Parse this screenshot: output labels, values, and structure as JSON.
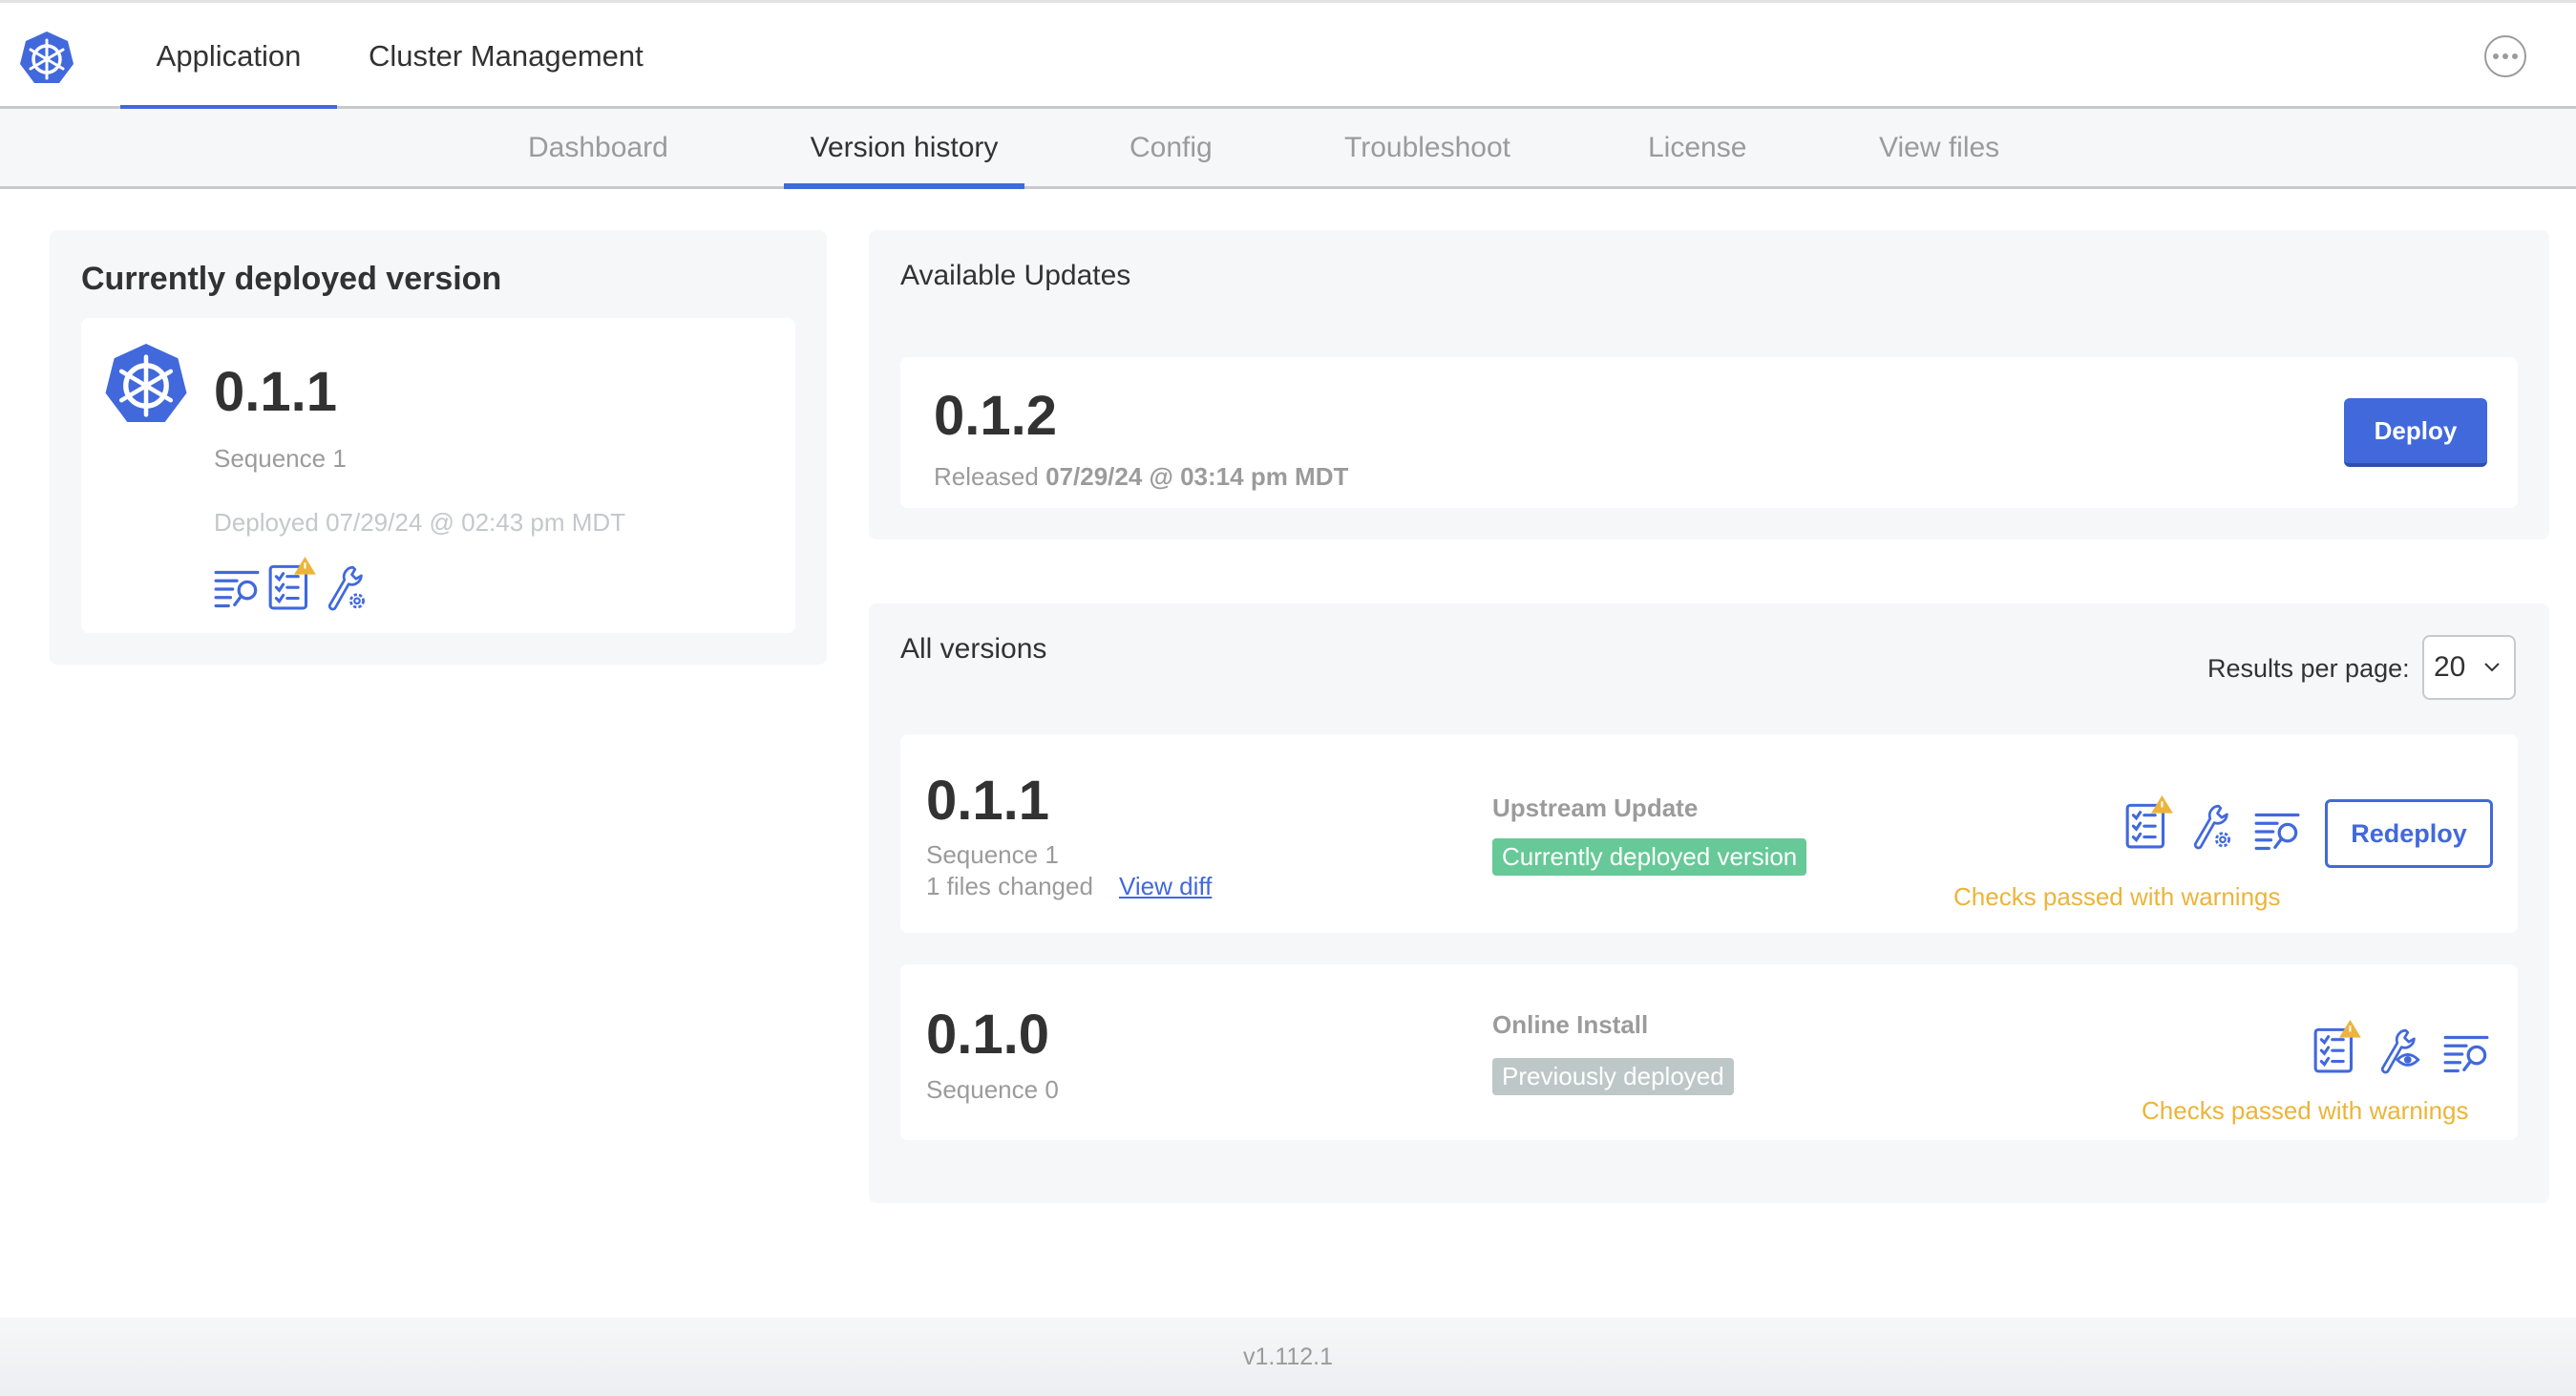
{
  "header": {
    "logo_icon": "kubernetes-helm-logo-icon",
    "tabs": [
      {
        "label": "Application",
        "active": true
      },
      {
        "label": "Cluster Management",
        "active": false
      }
    ],
    "more_icon": "ellipsis-circle-icon"
  },
  "subnav": {
    "tabs": [
      {
        "label": "Dashboard",
        "active": false
      },
      {
        "label": "Version history",
        "active": true
      },
      {
        "label": "Config",
        "active": false
      },
      {
        "label": "Troubleshoot",
        "active": false
      },
      {
        "label": "License",
        "active": false
      },
      {
        "label": "View files",
        "active": false
      }
    ]
  },
  "current": {
    "title": "Currently deployed version",
    "version": "0.1.1",
    "sequence": "Sequence 1",
    "deployed": "Deployed 07/29/24 @ 02:43 pm MDT",
    "icons": [
      "view-logs-icon",
      "preflight-checks-warning-icon",
      "edit-config-icon"
    ]
  },
  "updates": {
    "title": "Available Updates",
    "version": "0.1.2",
    "released_label": "Released",
    "released_date": "07/29/24 @ 03:14 pm MDT",
    "deploy_label": "Deploy"
  },
  "all_versions": {
    "title": "All versions",
    "results_label": "Results per page:",
    "results_value": "20",
    "rows": [
      {
        "version": "0.1.1",
        "sequence": "Sequence 1",
        "files_changed": "1 files changed",
        "view_diff": "View diff",
        "source": "Upstream Update",
        "status": "Currently deployed version",
        "status_color": "#66c997",
        "checks": "Checks passed with warnings",
        "action": "Redeploy"
      },
      {
        "version": "0.1.0",
        "sequence": "Sequence 0",
        "source": "Online Install",
        "status": "Previously deployed",
        "status_color": "#bec7c8",
        "checks": "Checks passed with warnings"
      }
    ]
  },
  "footer": {
    "version": "v1.112.1"
  },
  "colors": {
    "accent": "#4169dc",
    "warning": "#ecb43a",
    "success": "#66c997"
  }
}
